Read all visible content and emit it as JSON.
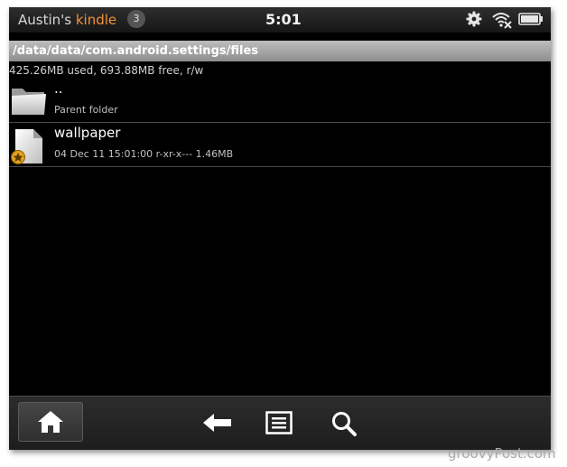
{
  "status_bar": {
    "owner_name": "Austin's",
    "owner_brand": "kindle",
    "notification_count": "3",
    "time": "5:01",
    "icons": [
      "gear-icon",
      "wifi-icon",
      "battery-icon"
    ],
    "brand_color": "#f0923a"
  },
  "path_bar": {
    "path": "/data/data/com.android.settings/files"
  },
  "storage_info": "425.26MB used, 693.88MB free, r/w",
  "files": [
    {
      "name": "..",
      "detail": "Parent folder",
      "icon": "folder-icon"
    },
    {
      "name": "wallpaper",
      "detail": "04 Dec 11 15:01:00  r-xr-x---  1.46MB",
      "icon": "file-badge-icon"
    }
  ],
  "bottom_nav": [
    "home-icon",
    "back-icon",
    "menu-icon",
    "search-icon"
  ],
  "watermark": "groovyPost.com"
}
